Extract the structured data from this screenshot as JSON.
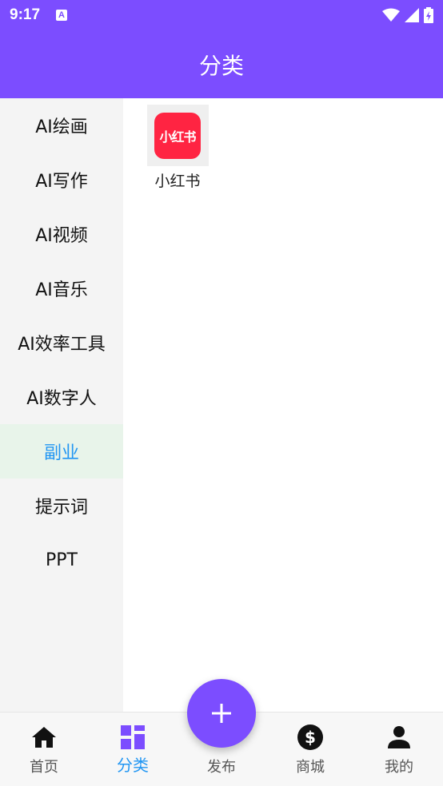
{
  "status_bar": {
    "time": "9:17",
    "notification_icon": "A"
  },
  "app_bar": {
    "title": "分类"
  },
  "sidebar": {
    "items": [
      {
        "label": "AI绘画"
      },
      {
        "label": "AI写作"
      },
      {
        "label": "AI视频"
      },
      {
        "label": "AI音乐"
      },
      {
        "label": "AI效率工具"
      },
      {
        "label": "AI数字人"
      },
      {
        "label": "副业",
        "active": true
      },
      {
        "label": "提示词"
      },
      {
        "label": "PPT"
      }
    ]
  },
  "content": {
    "tiles": [
      {
        "label": "小红书",
        "logo_text": "小红书",
        "logo_color": "#ff2442"
      }
    ]
  },
  "bottom_nav": {
    "items": [
      {
        "label": "首页",
        "icon": "home-icon"
      },
      {
        "label": "分类",
        "icon": "grid-icon",
        "active": true
      },
      {
        "label": "发布",
        "icon": "plus-icon"
      },
      {
        "label": "商城",
        "icon": "dollar-icon"
      },
      {
        "label": "我的",
        "icon": "person-icon"
      }
    ]
  },
  "colors": {
    "primary": "#7c4dff",
    "accent": "#2196f3",
    "active_bg": "#e8f4ea"
  }
}
